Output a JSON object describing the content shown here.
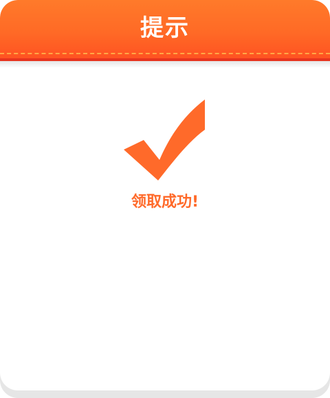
{
  "dialog": {
    "title": "提示",
    "message": "领取成功!",
    "status_icon": "checkmark-icon"
  },
  "colors": {
    "header_top": "#ff7a2a",
    "header_bottom": "#ff5322",
    "accent": "#ff6a2a",
    "dash": "#ffb14a"
  }
}
